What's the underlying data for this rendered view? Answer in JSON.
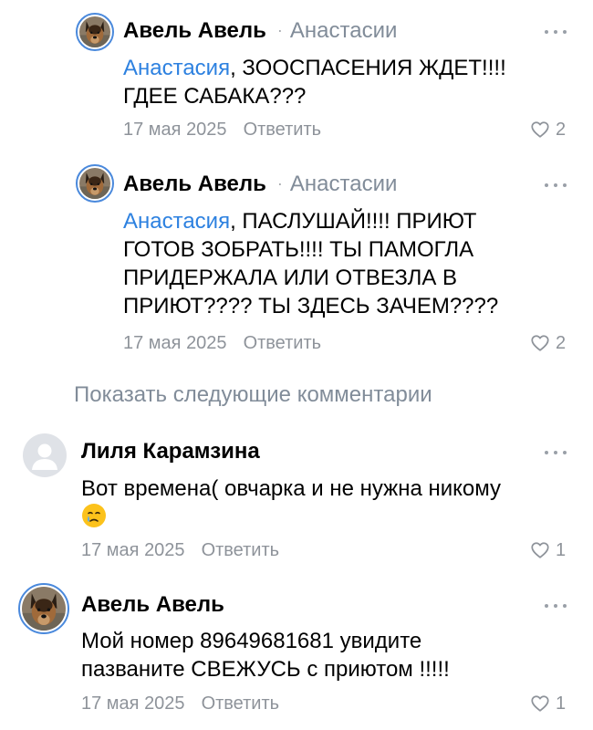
{
  "comments": [
    {
      "author": "Авель Авель",
      "separator": "·",
      "reply_to": "Анастасии",
      "mention": "Анастасия",
      "text_line1_rest": ", ЗООСПАСЕНИЯ ЖДЕТ!!!!",
      "text_line2": "ГДЕЕ САБАКА???",
      "date": "17 мая 2025",
      "reply_label": "Ответить",
      "likes": "2"
    },
    {
      "author": "Авель Авель",
      "separator": "·",
      "reply_to": "Анастасии",
      "mention": "Анастасия",
      "text_line1_rest": ", ПАСЛУШАЙ!!!! ПРИЮТ",
      "text_line2": "ГОТОВ ЗОБРАТЬ!!!! ТЫ ПАМОГЛА",
      "text_line3": "ПРИДЕРЖАЛА ИЛИ ОТВЕЗЛА В",
      "text_line4": "ПРИЮТ???? ТЫ ЗДЕСЬ ЗАЧЕМ????",
      "date": "17 мая 2025",
      "reply_label": "Ответить",
      "likes": "2"
    },
    {
      "author": "Лиля Карамзина",
      "text_line1": "Вот времена( овчарка и не нужна никому",
      "emoji": "crying-face-emoji",
      "date": "17 мая 2025",
      "reply_label": "Ответить",
      "likes": "1"
    },
    {
      "author": "Авель Авель",
      "text_line1": "Мой номер 89649681681 увидите",
      "text_line2": "пазваните СВЕЖУСЬ с приютом !!!!!",
      "date": "17 мая 2025",
      "reply_label": "Ответить",
      "likes": "1"
    }
  ],
  "show_more": "Показать следующие комментарии",
  "icons": {
    "more": "more-dots-icon",
    "like": "heart-outline-icon",
    "avatar_placeholder": "user-placeholder-icon"
  },
  "colors": {
    "accent": "#2d81e0",
    "secondary_text": "#818c99",
    "meta_text": "#8e939a",
    "avatar_ring": "#4a89dc"
  }
}
